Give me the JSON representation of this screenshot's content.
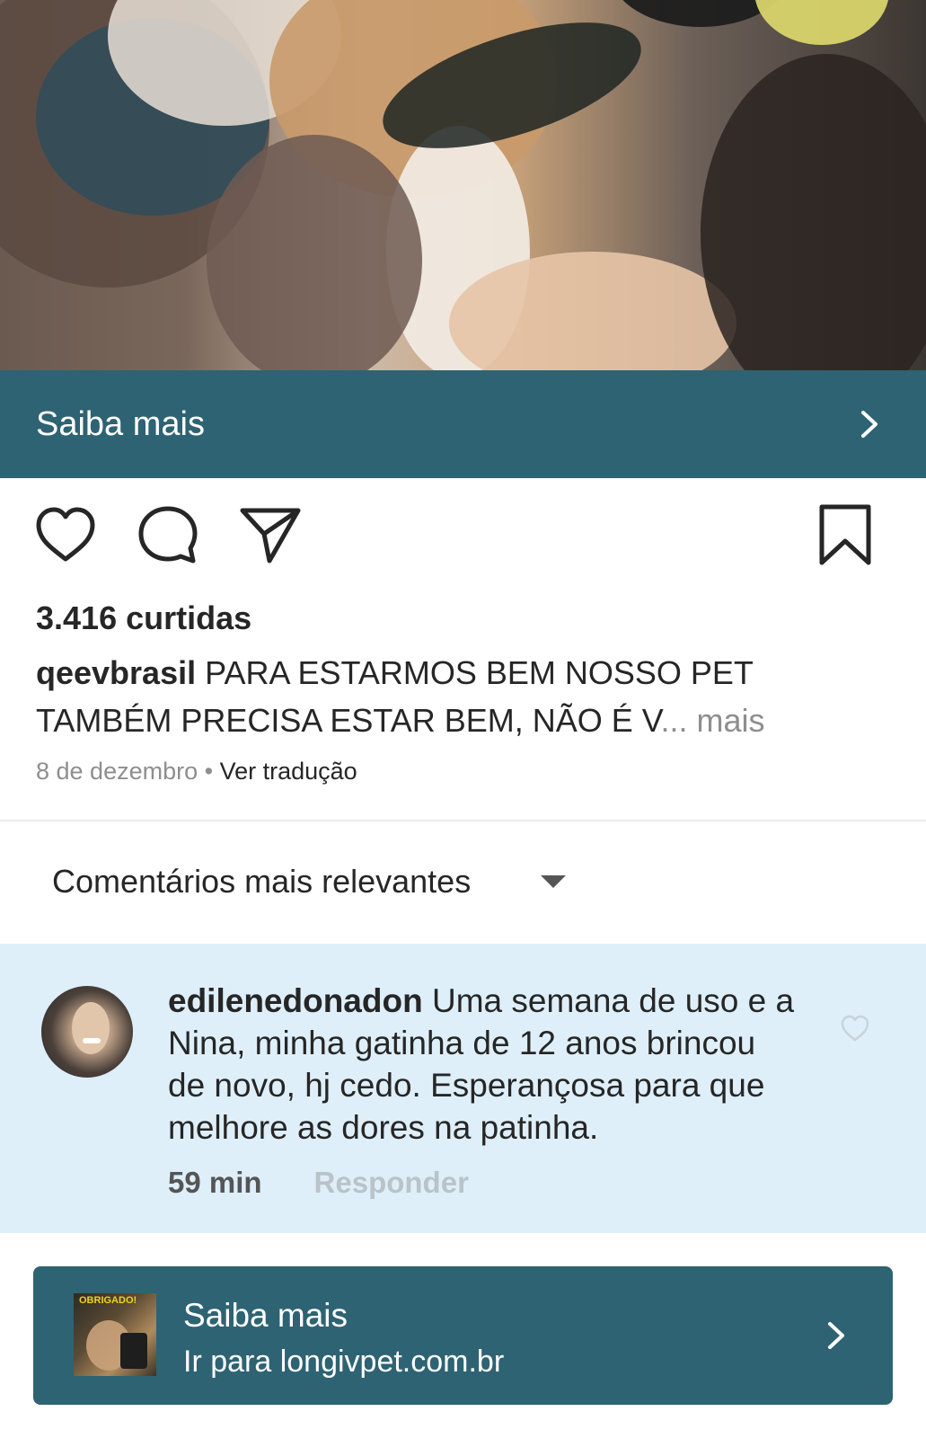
{
  "cta_bar": {
    "label": "Saiba mais"
  },
  "actions": {
    "like_icon": "heart-icon",
    "comment_icon": "comment-icon",
    "share_icon": "send-icon",
    "save_icon": "bookmark-icon"
  },
  "post": {
    "likes": "3.416 curtidas",
    "username": "qeevbrasil",
    "caption": " PARA ESTARMOS BEM NOSSO PET TAMBÉM PRECISA ESTAR BEM, NÃO É V",
    "ellipsis_more": "... mais",
    "date": "8 de dezembro",
    "separator": " • ",
    "translate": "Ver tradução"
  },
  "comments_sort": {
    "label": "Comentários mais relevantes"
  },
  "comment": {
    "username": "edilenedonadon",
    "text": " Uma semana de uso e a Nina, minha gatinha de 12 anos brincou de novo, hj cedo. Esperançosa para que melhore as dores na patinha.",
    "time": "59 min",
    "reply": "Responder"
  },
  "link_card": {
    "thumb_text": "OBRIGADO!",
    "title": "Saiba mais",
    "subtitle": "Ir para longivpet.com.br"
  },
  "colors": {
    "accent": "#2e6373",
    "comment_bg": "#deeffa",
    "muted": "#8e8e8e"
  }
}
